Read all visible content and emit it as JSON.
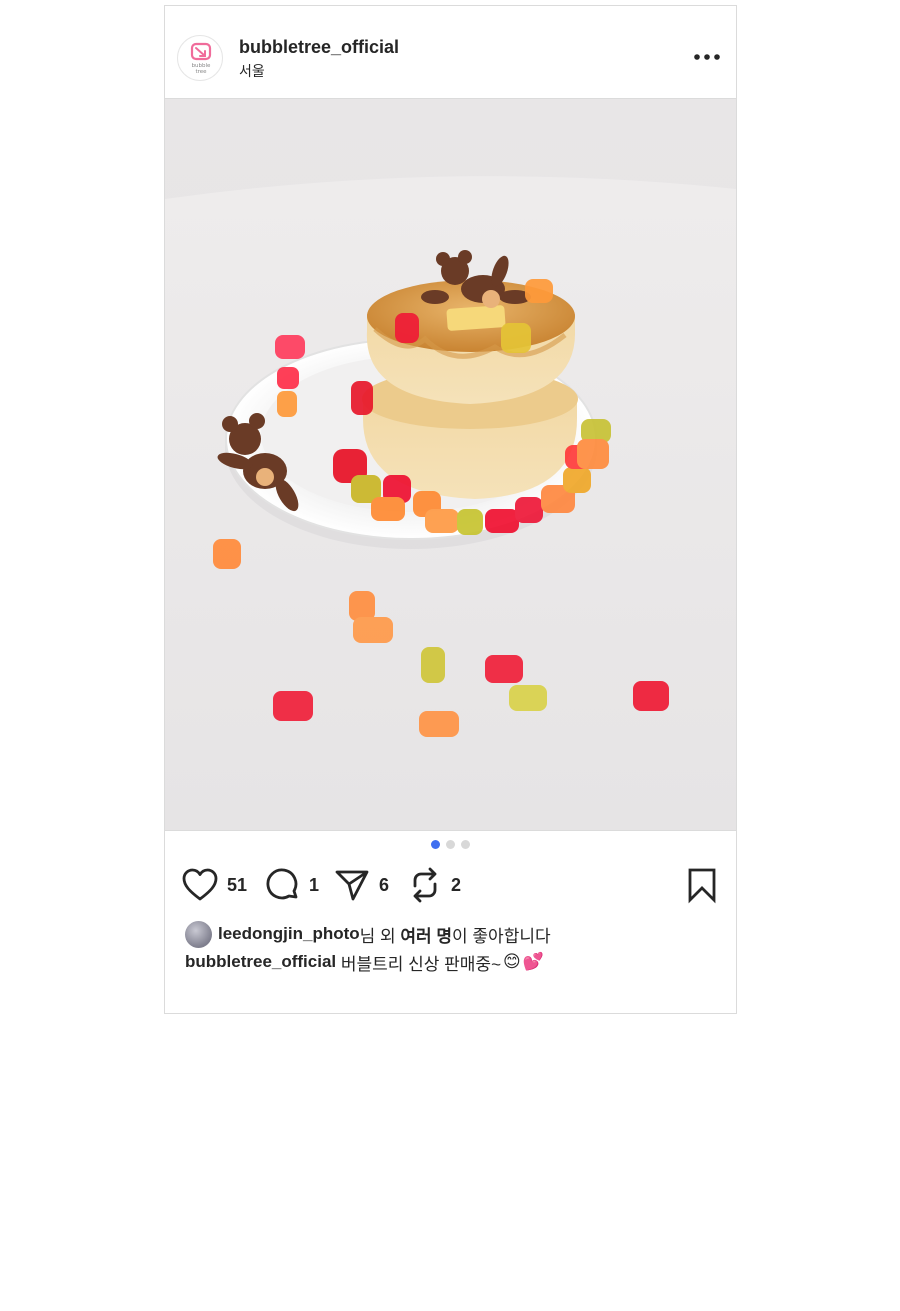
{
  "post": {
    "username": "bubbletree_official",
    "location": "서울",
    "avatar_icon": "bubbletree-logo-icon",
    "more_icon": "more-horizontal-icon",
    "image_alt": "fluffy pancakes with gummy bears and teddy bears",
    "carousel": {
      "count": 3,
      "active_index": 0
    },
    "actions": {
      "like": {
        "icon": "heart-icon",
        "count": "51"
      },
      "comment": {
        "icon": "comment-icon",
        "count": "1"
      },
      "share": {
        "icon": "send-icon",
        "count": "6"
      },
      "repost": {
        "icon": "repost-icon",
        "count": "2"
      },
      "save": {
        "icon": "bookmark-icon"
      }
    },
    "likes": {
      "user": "leedongjin_photo",
      "suffix1": "님 외 ",
      "others": "여러 명",
      "suffix2": "이 좋아합니다"
    },
    "caption": {
      "user": "bubbletree_official",
      "text": " 버블트리 신상 판매중~",
      "emoji1": "😊",
      "emoji2": "💕"
    }
  },
  "colors": {
    "accent_dot": "#3f6ff0",
    "border": "#dbdbdb",
    "logo_pink": "#f06c9b"
  }
}
